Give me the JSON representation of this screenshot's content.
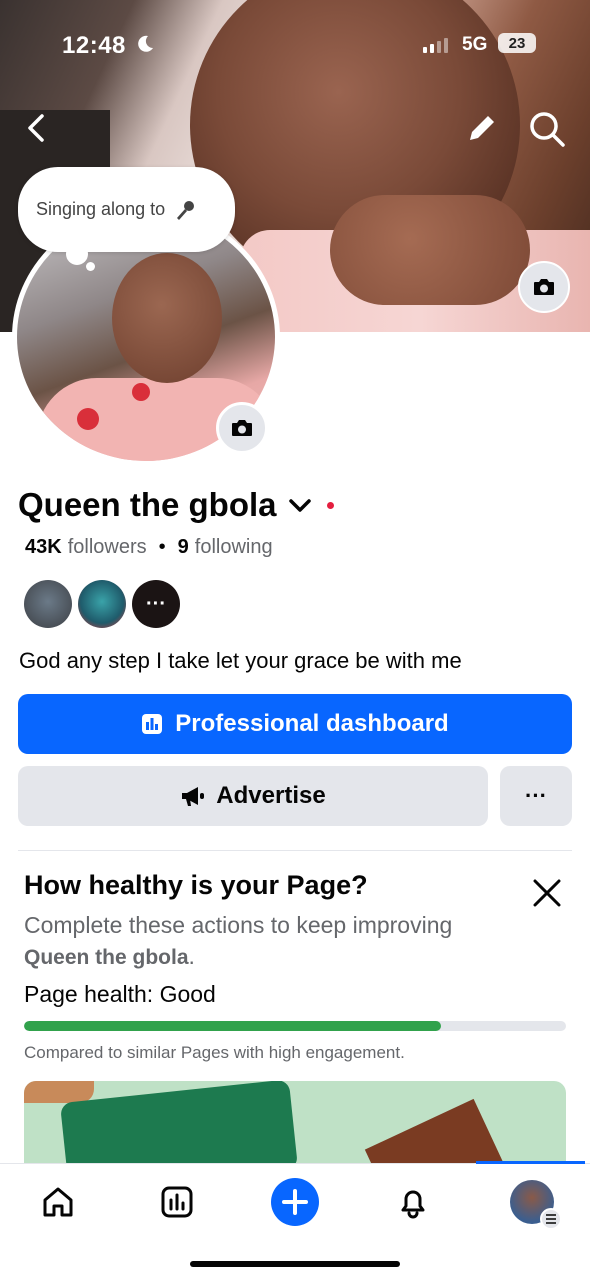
{
  "status_bar": {
    "time": "12:48",
    "network": "5G",
    "battery": "23"
  },
  "note_bubble": {
    "text": "Singing along to"
  },
  "profile": {
    "name": "Queen the gbola",
    "followers_count": "43K",
    "followers_label": "followers",
    "separator": "•",
    "following_count": "9",
    "following_label": "following",
    "friend_more_label": "···",
    "bio": "God any step I take let your grace be with me"
  },
  "actions": {
    "professional_dashboard_label": "Professional dashboard",
    "advertise_label": "Advertise",
    "more_label": "···"
  },
  "page_health": {
    "title": "How healthy is your Page?",
    "description_prefix": "Complete these actions to keep improving",
    "page_name": "Queen the gbola",
    "description_suffix": ".",
    "status_label": "Page health:",
    "status_value": "Good",
    "progress_fraction": 0.77,
    "note": "Compared to similar Pages with high engagement."
  },
  "tab_bar": {
    "items": [
      "home-icon",
      "dashboard-icon",
      "create-icon",
      "notifications-icon",
      "profile-avatar"
    ],
    "active": "profile-avatar"
  },
  "colors": {
    "accent": "#0866ff",
    "health_good": "#31a24c",
    "secondary_button": "#e4e6eb",
    "status_dot": "#e41e3f"
  }
}
